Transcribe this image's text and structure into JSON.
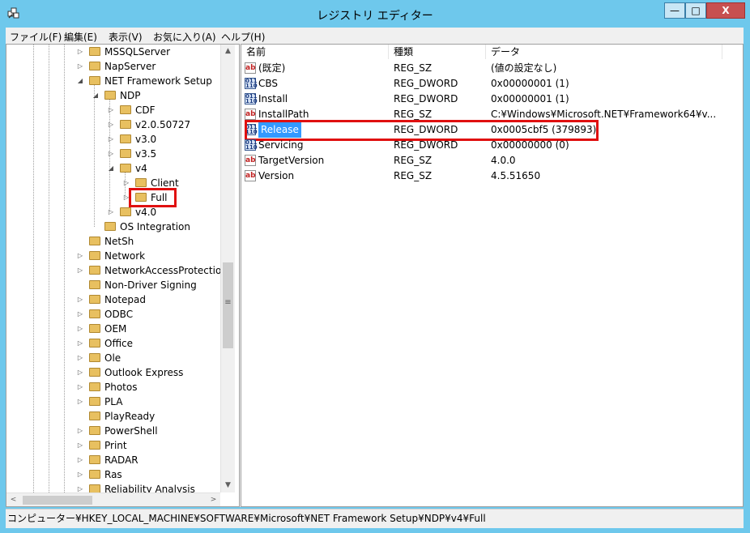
{
  "window": {
    "title": "レジストリ エディター",
    "min_label": "—",
    "max_label": "□",
    "close_label": "X"
  },
  "menu": [
    "ファイル(F)",
    "編集(E)",
    "表示(V)",
    "お気に入り(A)",
    "ヘルプ(H)"
  ],
  "tree": {
    "nodes": [
      {
        "label": "MSSQLServer",
        "expander": "▷"
      },
      {
        "label": "NapServer",
        "expander": "▷"
      },
      {
        "label": "NET Framework Setup",
        "expander": "◢"
      },
      {
        "label": "NDP",
        "expander": "◢"
      },
      {
        "label": "CDF",
        "expander": "▷"
      },
      {
        "label": "v2.0.50727",
        "expander": "▷"
      },
      {
        "label": "v3.0",
        "expander": "▷"
      },
      {
        "label": "v3.5",
        "expander": "▷"
      },
      {
        "label": "v4",
        "expander": "◢"
      },
      {
        "label": "Client",
        "expander": "▷"
      },
      {
        "label": "Full",
        "expander": "▷"
      },
      {
        "label": "v4.0",
        "expander": "▷"
      },
      {
        "label": "OS Integration",
        "expander": ""
      },
      {
        "label": "NetSh",
        "expander": ""
      },
      {
        "label": "Network",
        "expander": "▷"
      },
      {
        "label": "NetworkAccessProtection",
        "expander": "▷"
      },
      {
        "label": "Non-Driver Signing",
        "expander": ""
      },
      {
        "label": "Notepad",
        "expander": "▷"
      },
      {
        "label": "ODBC",
        "expander": "▷"
      },
      {
        "label": "OEM",
        "expander": "▷"
      },
      {
        "label": "Office",
        "expander": "▷"
      },
      {
        "label": "Ole",
        "expander": "▷"
      },
      {
        "label": "Outlook Express",
        "expander": "▷"
      },
      {
        "label": "Photos",
        "expander": "▷"
      },
      {
        "label": "PLA",
        "expander": "▷"
      },
      {
        "label": "PlayReady",
        "expander": ""
      },
      {
        "label": "PowerShell",
        "expander": "▷"
      },
      {
        "label": "Print",
        "expander": "▷"
      },
      {
        "label": "RADAR",
        "expander": "▷"
      },
      {
        "label": "Ras",
        "expander": "▷"
      },
      {
        "label": "Reliability Analysis",
        "expander": "▷"
      }
    ],
    "scroll_up": "▲",
    "scroll_down": "▼",
    "scroll_grip": "≡",
    "scroll_left": "<",
    "scroll_right": ">"
  },
  "values": {
    "columns": [
      "名前",
      "種類",
      "データ"
    ],
    "rows": [
      {
        "name": "(既定)",
        "type": "REG_SZ",
        "data": "(値の設定なし)",
        "icon": "reg-sz-icon",
        "icon_text": "ab"
      },
      {
        "name": "CBS",
        "type": "REG_DWORD",
        "data": "0x00000001 (1)",
        "icon": "reg-dword-icon",
        "icon_text": "011 110"
      },
      {
        "name": "Install",
        "type": "REG_DWORD",
        "data": "0x00000001 (1)",
        "icon": "reg-dword-icon",
        "icon_text": "011 110"
      },
      {
        "name": "InstallPath",
        "type": "REG_SZ",
        "data": "C:¥Windows¥Microsoft.NET¥Framework64¥v...",
        "icon": "reg-sz-icon",
        "icon_text": "ab"
      },
      {
        "name": "Release",
        "type": "REG_DWORD",
        "data": "0x0005cbf5 (379893)",
        "icon": "reg-dword-icon",
        "icon_text": "011 110"
      },
      {
        "name": "Servicing",
        "type": "REG_DWORD",
        "data": "0x00000000 (0)",
        "icon": "reg-dword-icon",
        "icon_text": "011 110"
      },
      {
        "name": "TargetVersion",
        "type": "REG_SZ",
        "data": "4.0.0",
        "icon": "reg-sz-icon",
        "icon_text": "ab"
      },
      {
        "name": "Version",
        "type": "REG_SZ",
        "data": "4.5.51650",
        "icon": "reg-sz-icon",
        "icon_text": "ab"
      }
    ]
  },
  "status": {
    "path": "コンピューター¥HKEY_LOCAL_MACHINE¥SOFTWARE¥Microsoft¥NET Framework Setup¥NDP¥v4¥Full"
  },
  "colors": {
    "titlebar": "#6ec8ec",
    "highlight_box": "#e01010",
    "selection": "#3399ff"
  }
}
